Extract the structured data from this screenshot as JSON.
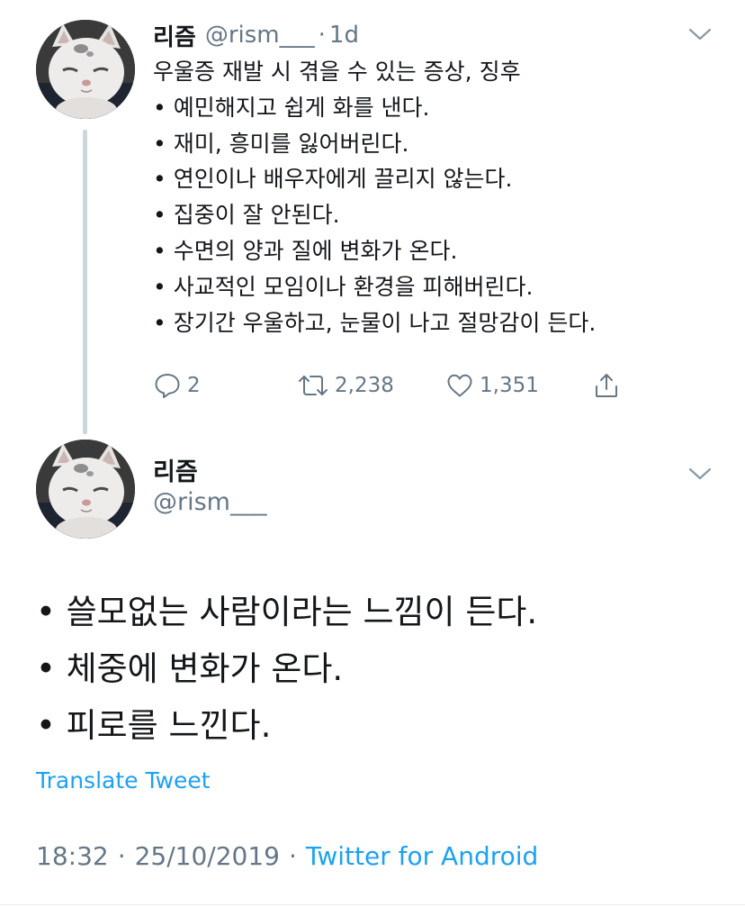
{
  "tweet1": {
    "display_name": "리즘",
    "handle": "@rism___",
    "separator": "·",
    "time": "1d",
    "lines": [
      "우울증 재발 시 겪을 수 있는 증상, 징후",
      "• 예민해지고 쉽게 화를 낸다.",
      "• 재미, 흥미를 잃어버린다.",
      "• 연인이나 배우자에게 끌리지 않는다.",
      "• 집중이 잘 안된다.",
      "• 수면의 양과 질에 변화가 온다.",
      "• 사교적인 모임이나 환경을 피해버린다.",
      "• 장기간 우울하고, 눈물이 나고 절망감이 든다."
    ],
    "actions": {
      "reply_count": "2",
      "retweet_count": "2,238",
      "like_count": "1,351"
    }
  },
  "tweet2": {
    "display_name": "리즘",
    "handle": "@rism___",
    "lines": [
      "• 쓸모없는 사람이라는 느낌이 든다.",
      "• 체중에 변화가 온다.",
      "• 피로를 느낀다."
    ],
    "translate_label": "Translate Tweet",
    "meta": {
      "time": "18:32",
      "date": "25/10/2019",
      "separator": "·",
      "source": "Twitter for Android"
    }
  },
  "icons": {
    "avatar": "white-kitten-avatar",
    "menu": "chevron-down-icon",
    "reply": "reply-icon",
    "retweet": "retweet-icon",
    "like": "heart-icon",
    "share": "share-icon"
  },
  "colors": {
    "text": "#14171a",
    "secondary": "#657786",
    "accent": "#1da1f2",
    "thread_line": "#ccd6dd"
  }
}
